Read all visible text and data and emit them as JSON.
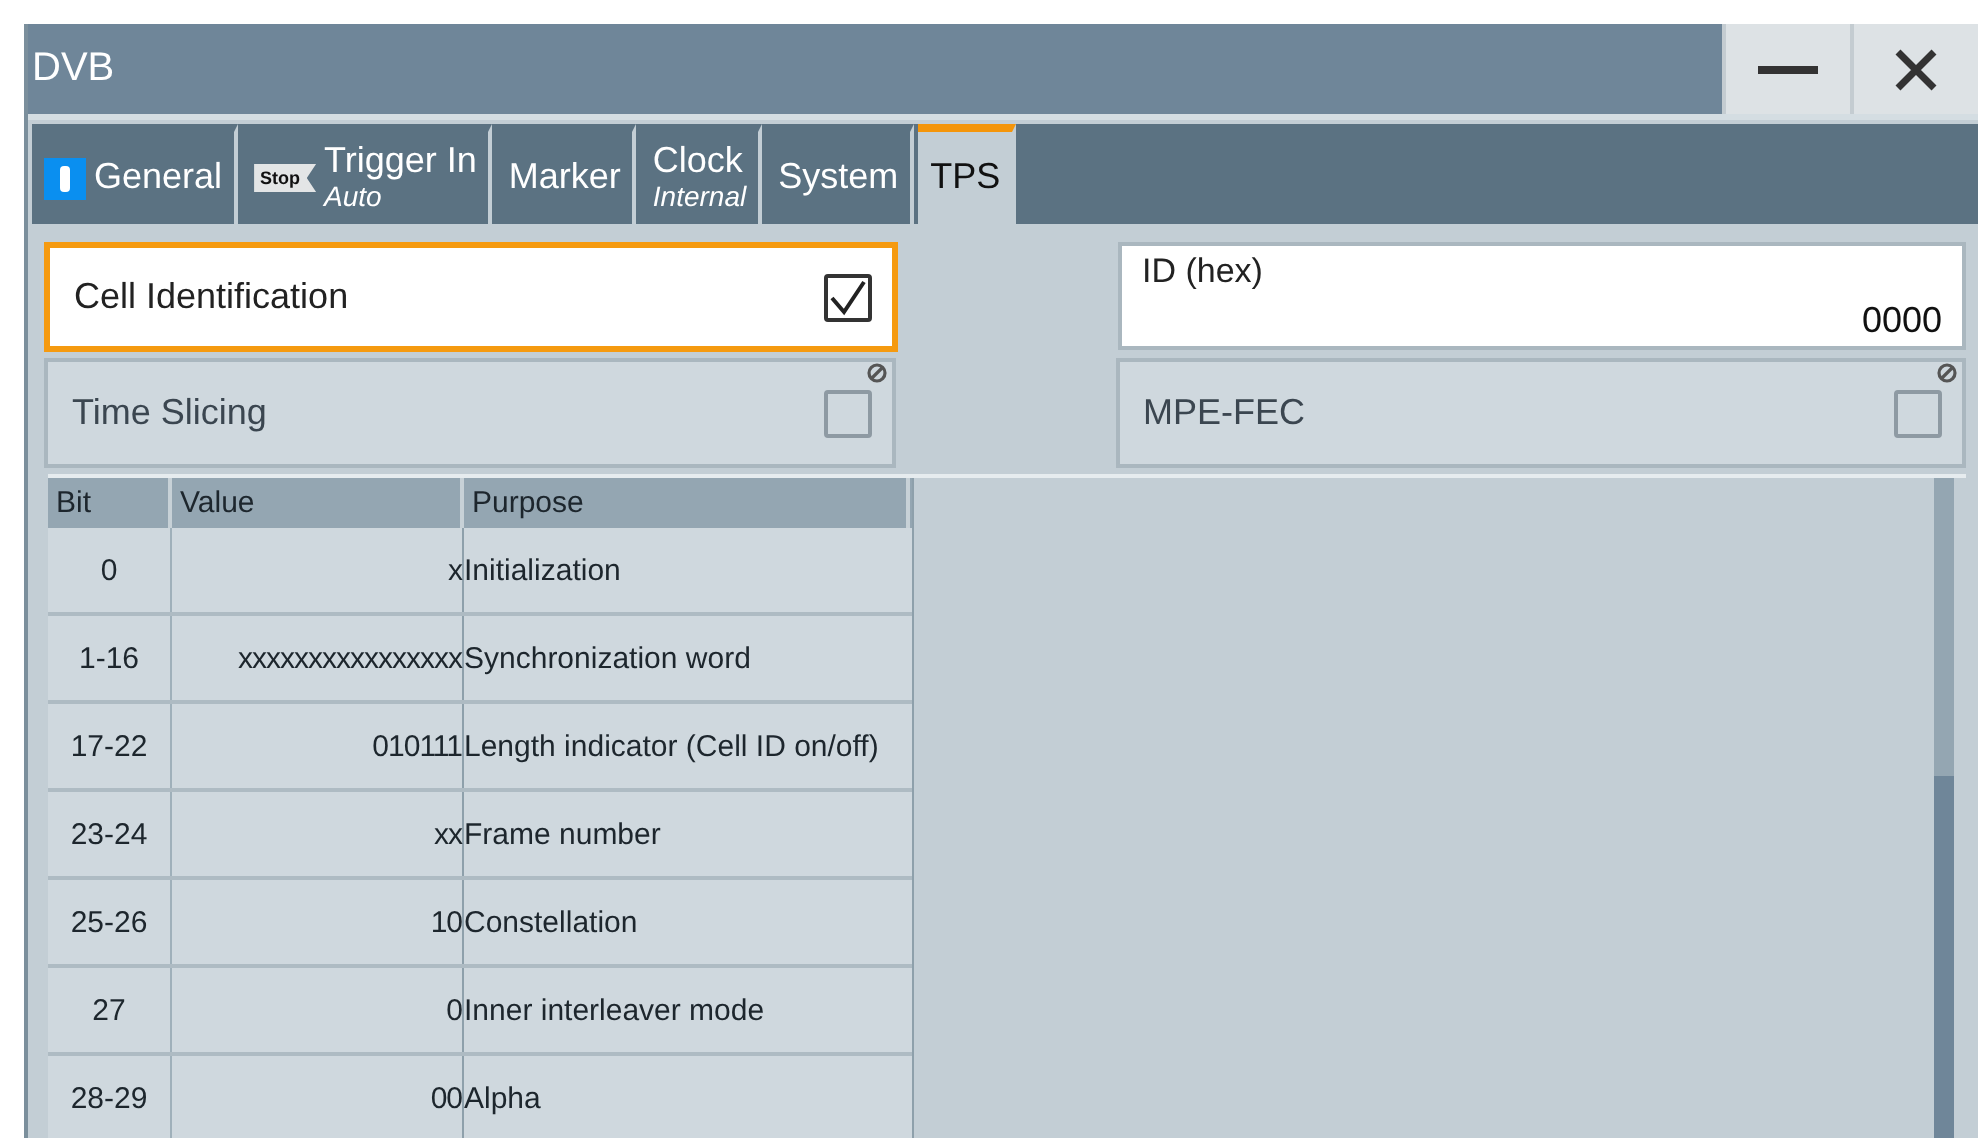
{
  "window": {
    "title": "DVB"
  },
  "tabs": [
    {
      "kind": "info",
      "label": "General",
      "selected": false
    },
    {
      "kind": "badge",
      "label": "Trigger In",
      "sublabel": "Auto",
      "badge": "Stop",
      "selected": false
    },
    {
      "kind": "plain",
      "label": "Marker",
      "selected": false
    },
    {
      "kind": "plain",
      "label": "Clock",
      "sublabel": "Internal",
      "selected": false
    },
    {
      "kind": "plain",
      "label": "System",
      "selected": false
    },
    {
      "kind": "plain",
      "label": "TPS",
      "selected": true
    }
  ],
  "cell_identification": {
    "label": "Cell Identification",
    "checked": true,
    "disabled": false,
    "focused": true
  },
  "time_slicing": {
    "label": "Time Slicing",
    "checked": false,
    "disabled": true,
    "focused": false
  },
  "id_field": {
    "label": "ID (hex)",
    "value": "0000"
  },
  "mpe_fec": {
    "label": "MPE-FEC",
    "checked": false,
    "disabled": true,
    "focused": false
  },
  "table": {
    "columns": [
      "Bit",
      "Value",
      "Purpose"
    ],
    "rows": [
      [
        "0",
        "x",
        "Initialization"
      ],
      [
        "1-16",
        "xxxxxxxxxxxxxxxx",
        "Synchronization word"
      ],
      [
        "17-22",
        "010111",
        "Length indicator (Cell ID on/off)"
      ],
      [
        "23-24",
        "xx",
        "Frame number"
      ],
      [
        "25-26",
        "10",
        "Constellation"
      ],
      [
        "27",
        "0",
        "Inner interleaver mode"
      ],
      [
        "28-29",
        "00",
        "Alpha"
      ]
    ]
  }
}
